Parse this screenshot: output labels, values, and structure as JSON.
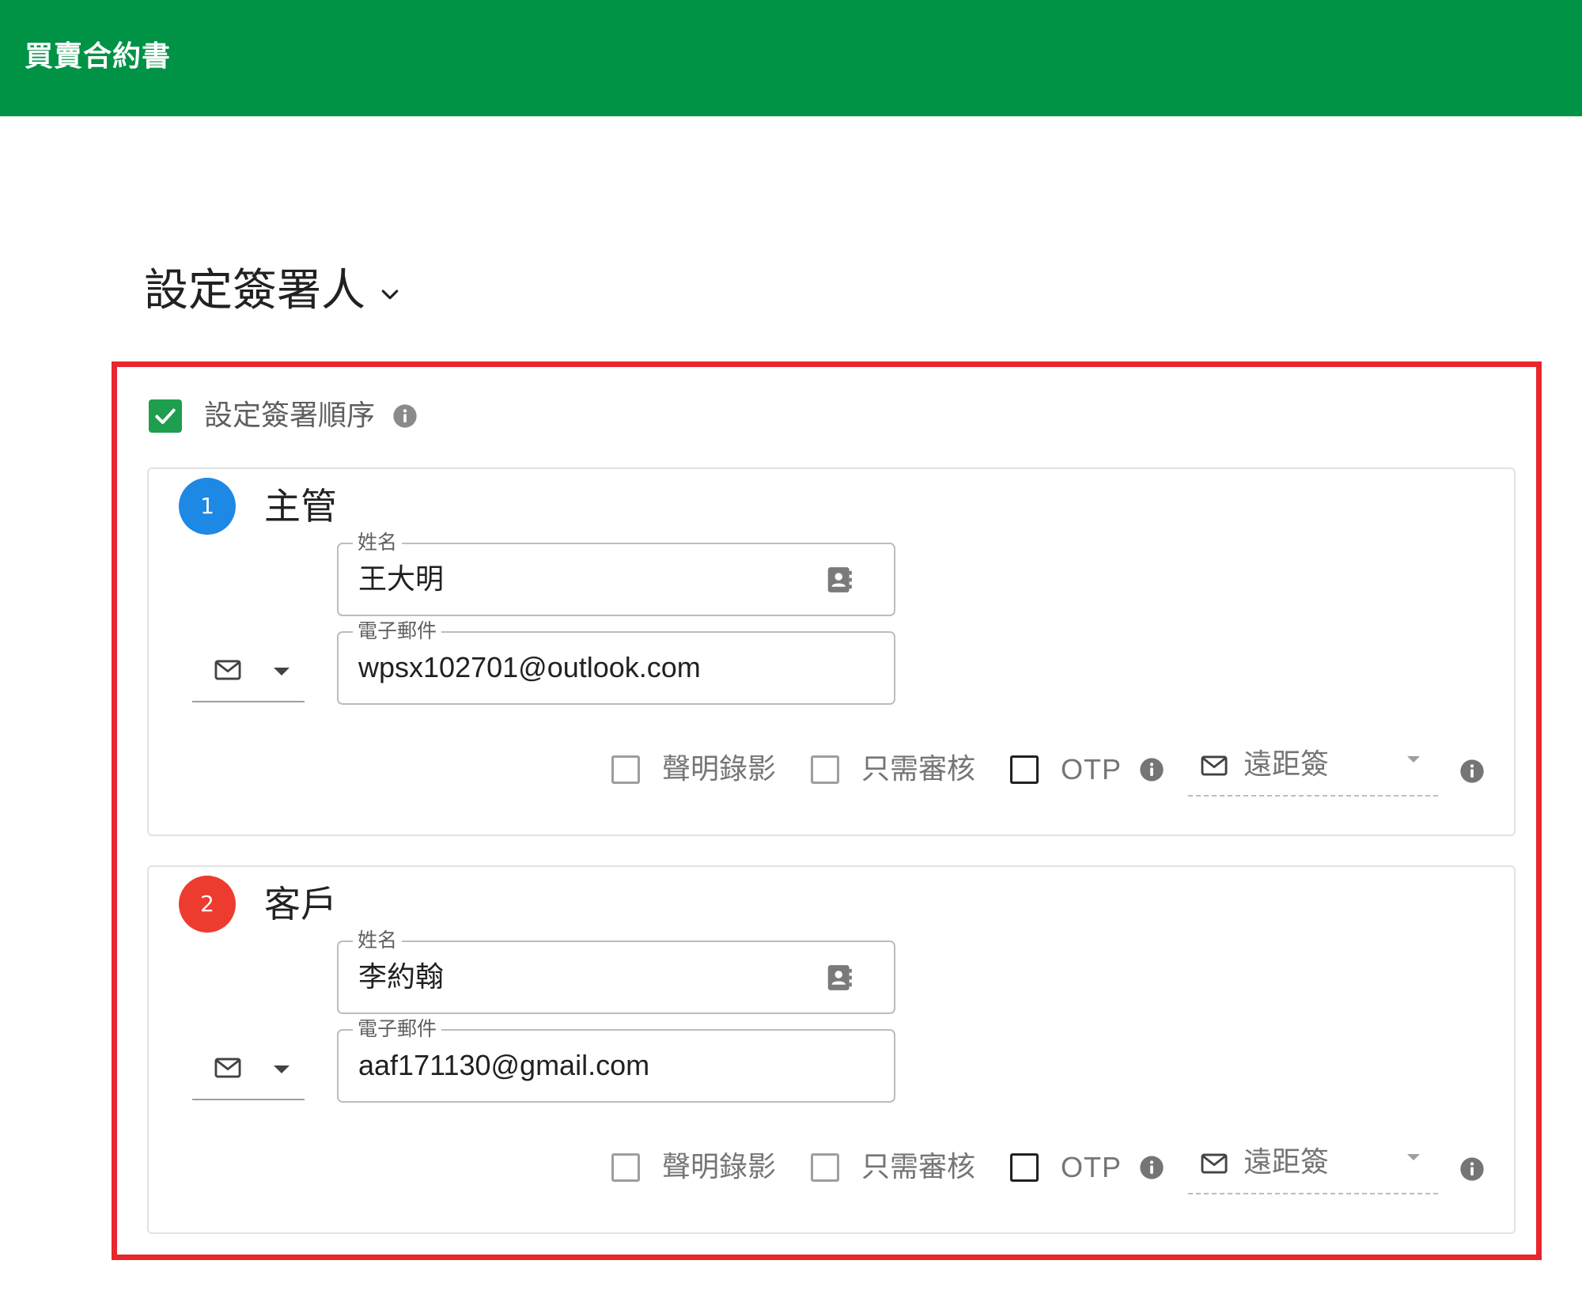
{
  "header": {
    "title": "買賣合約書"
  },
  "section": {
    "heading": "設定簽署人"
  },
  "signing_order": {
    "label": "設定簽署順序",
    "checked": true
  },
  "signers": [
    {
      "step": "1",
      "role": "主管",
      "badge_color": "#1e88e5",
      "name_label": "姓名",
      "name_value": "王大明",
      "email_label": "電子郵件",
      "email_value": "wpsx102701@outlook.com",
      "channel_icon": "mail-icon",
      "options": {
        "video": "聲明錄影",
        "review": "只需審核",
        "otp": "OTP",
        "remote": "遠距簽"
      }
    },
    {
      "step": "2",
      "role": "客戶",
      "badge_color": "#ee3b2f",
      "name_label": "姓名",
      "name_value": "李約翰",
      "email_label": "電子郵件",
      "email_value": "aaf171130@gmail.com",
      "channel_icon": "mail-icon",
      "options": {
        "video": "聲明錄影",
        "review": "只需審核",
        "otp": "OTP",
        "remote": "遠距簽"
      }
    }
  ],
  "colors": {
    "header_bg": "#009245",
    "highlight_border": "#e8262c",
    "checkbox_checked": "#1e9e4e"
  }
}
